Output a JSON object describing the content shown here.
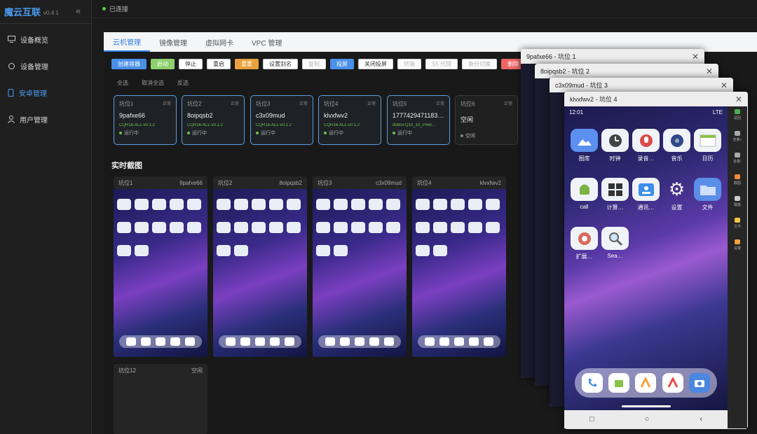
{
  "app": {
    "name": "魔云互联",
    "version": "v0.4.1",
    "collapse_icon": "double-chevron-left-icon"
  },
  "sidebar": {
    "items": [
      {
        "label": "设备概览",
        "icon": "monitor-icon"
      },
      {
        "label": "设备管理",
        "icon": "chip-icon"
      },
      {
        "label": "安卓管理",
        "icon": "phone-icon",
        "active": true
      },
      {
        "label": "用户管理",
        "icon": "user-icon"
      }
    ]
  },
  "status": {
    "text": "已连接",
    "color": "#5ec84a"
  },
  "tabs": [
    "云机管理",
    "镜像管理",
    "虚拟网卡",
    "VPC 管理"
  ],
  "toolbar": [
    "创建容器",
    "启动",
    "停止",
    "重启",
    "重置",
    "设置别名",
    "复制",
    "投屏",
    "关闭投屏",
    "终端",
    "S5 代理",
    "备份切换",
    "删除"
  ],
  "selection": [
    "全选",
    "取消全选",
    "反选"
  ],
  "slots": [
    {
      "pos": "坑位1",
      "state": "正常",
      "name": "9pafxe66",
      "image": "CQR16-ALL-v0.1.2",
      "run": "运行中"
    },
    {
      "pos": "坑位2",
      "state": "正常",
      "name": "8oipqsb2",
      "image": "CQR16-ALL-v0.1.2",
      "run": "运行中"
    },
    {
      "pos": "坑位3",
      "state": "正常",
      "name": "c3x09mud",
      "image": "CQR16-ALL-v0.1.2",
      "run": "运行中"
    },
    {
      "pos": "坑位4",
      "state": "正常",
      "name": "klvxfwv2",
      "image": "CQR16-ALL-v0.1.2",
      "run": "运行中"
    },
    {
      "pos": "坑位5",
      "state": "正常",
      "name": "1777429471183…",
      "image": "dobox:Q10_10_Pixel…",
      "run": "运行中"
    },
    {
      "pos": "坑位6",
      "state": "正常",
      "name": "空闲",
      "image": "",
      "run": "空闲"
    }
  ],
  "screenshots_title": "实时截图",
  "screenshots": [
    {
      "pos": "坑位1",
      "name": "9pafxe66"
    },
    {
      "pos": "坑位2",
      "name": "8oipqsb2"
    },
    {
      "pos": "坑位3",
      "name": "c3x09mud"
    },
    {
      "pos": "坑位4",
      "name": "klvxfwv2"
    }
  ],
  "slot12": {
    "pos": "坑位12",
    "state": "空闲"
  },
  "windows": [
    {
      "title": "9pafxe66 - 坑位 1"
    },
    {
      "title": "8oipqsb2 - 坑位 2"
    },
    {
      "title": "c3x09mud - 坑位 3"
    },
    {
      "title": "klvxfwv2 - 坑位 4"
    }
  ],
  "phone": {
    "time": "12:01",
    "signal": "LTE",
    "apps": [
      "图库",
      "时钟",
      "录音…",
      "音乐",
      "日历",
      "call",
      "计算…",
      "通讯…",
      "设置",
      "文件",
      "扩展…",
      "Sea…"
    ],
    "nav": [
      "□",
      "○",
      "‹"
    ]
  },
  "side_tools": [
    "返回",
    "音量+",
    "音量-",
    "截图",
    "键盘",
    "文件",
    "设置"
  ]
}
